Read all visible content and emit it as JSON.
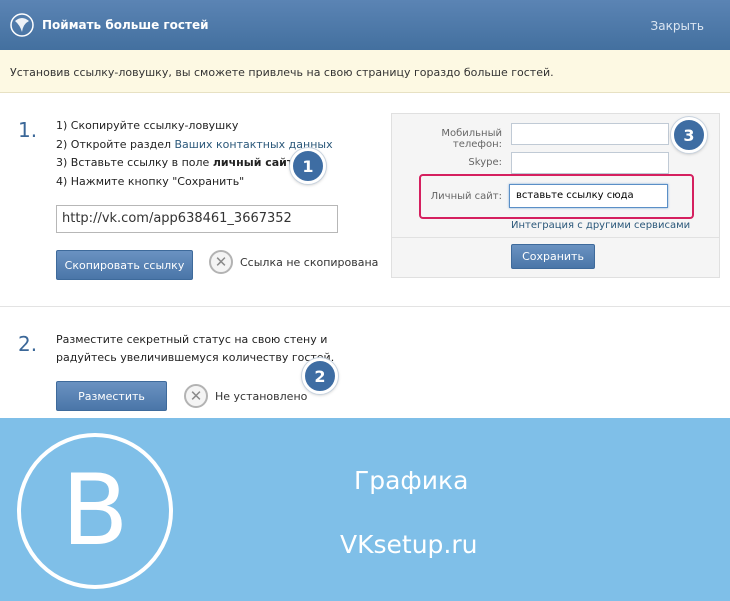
{
  "header": {
    "title": "Поймать больше гостей",
    "close_label": "Закрыть"
  },
  "notice": "Установив ссылку-ловушку, вы сможете привлечь на свою страницу гораздо больше гостей.",
  "step1": {
    "number": "1.",
    "instructions": {
      "line1": "1) Скопируйте ссылку-ловушку",
      "line2_prefix": "2) Откройте раздел ",
      "line2_link": "Ваших контактных данных",
      "line3_prefix": "3) Вставьте ссылку в поле ",
      "line3_bold": "личный сайт",
      "line4": "4) Нажмите кнопку \"Сохранить\""
    },
    "badge": "1",
    "link_value": "http://vk.com/app638461_3667352",
    "copy_button": "Скопировать ссылку",
    "status": "Ссылка не скопирована"
  },
  "panel": {
    "badge": "3",
    "mobile_label": "Мобильный телефон:",
    "skype_label": "Skype:",
    "site_label": "Личный сайт:",
    "site_value": "вставьте ссылку сюда",
    "integration_link": "Интеграция с другими сервисами",
    "save_button": "Сохранить"
  },
  "step2": {
    "number": "2.",
    "text": "Разместите секретный статус на свою стену и радуйтесь увеличившемуся количеству гостей.",
    "badge": "2",
    "place_button": "Разместить",
    "status": "Не установлено"
  },
  "promo": {
    "logo_letter": "B",
    "line1": "Графика",
    "line2": "VKsetup.ru"
  },
  "colors": {
    "header": "#4a76a8",
    "accent": "#3e6da3",
    "highlight": "#d5205f",
    "promo_bg": "#7fbfe8"
  }
}
